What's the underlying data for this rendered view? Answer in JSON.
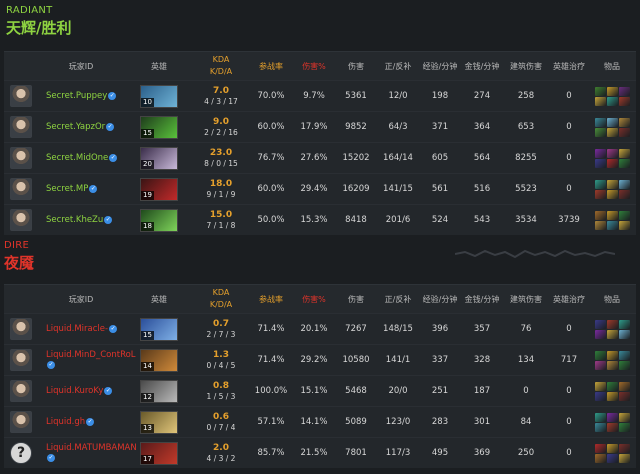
{
  "radiant": {
    "tag": "RADIANT",
    "name": "天辉/胜利",
    "players": [
      {
        "name": "Secret.Puppey",
        "level": "10",
        "kda": "7.0",
        "kda_parts": "4 / 3 / 17",
        "part": "70.0%",
        "dmg_pct": "9.7%",
        "dmg": "5361",
        "lh": "12/0",
        "xpm": "198",
        "gpm": "274",
        "bld": "258",
        "heal": "0",
        "hero_colors": [
          "#2b5f8a",
          "#6fb3d6"
        ],
        "item_colors": [
          "#3f7f2f",
          "#c59a2a",
          "#6a2d7d",
          "#c6a53a",
          "#2f9c8a",
          "#a03a2a"
        ]
      },
      {
        "name": "Secret.YapzOr",
        "level": "15",
        "kda": "9.0",
        "kda_parts": "2 / 2 / 16",
        "part": "60.0%",
        "dmg_pct": "17.9%",
        "dmg": "9852",
        "lh": "64/3",
        "xpm": "371",
        "gpm": "364",
        "bld": "653",
        "heal": "0",
        "hero_colors": [
          "#1f3d1c",
          "#59c23b"
        ],
        "item_colors": [
          "#3a8a9a",
          "#6cb0d0",
          "#b0883a",
          "#4a8f3a",
          "#c6a53a",
          "#7b2f2a"
        ]
      },
      {
        "name": "Secret.MidOne",
        "level": "20",
        "kda": "23.0",
        "kda_parts": "8 / 0 / 15",
        "part": "76.7%",
        "dmg_pct": "27.6%",
        "dmg": "15202",
        "lh": "164/14",
        "xpm": "605",
        "gpm": "564",
        "bld": "8255",
        "heal": "0",
        "hero_colors": [
          "#3a2d4a",
          "#c9b9d9"
        ],
        "item_colors": [
          "#7a2aa0",
          "#a03a8a",
          "#c6a53a",
          "#3a3a8a",
          "#b02a2a",
          "#2f7f3a"
        ]
      },
      {
        "name": "Secret.MP",
        "level": "19",
        "kda": "18.0",
        "kda_parts": "9 / 1 / 9",
        "part": "60.0%",
        "dmg_pct": "29.4%",
        "dmg": "16209",
        "lh": "141/15",
        "xpm": "561",
        "gpm": "516",
        "bld": "5523",
        "heal": "0",
        "hero_colors": [
          "#3a1414",
          "#c22a2a"
        ],
        "item_colors": [
          "#2f9c8a",
          "#c6a53a",
          "#6cb0d0",
          "#a03a2a",
          "#c59a2a",
          "#7b2f2a"
        ]
      },
      {
        "name": "Secret.KheZu",
        "level": "18",
        "kda": "15.0",
        "kda_parts": "7 / 1 / 8",
        "part": "50.0%",
        "dmg_pct": "15.3%",
        "dmg": "8418",
        "lh": "201/6",
        "xpm": "524",
        "gpm": "543",
        "bld": "3534",
        "heal": "3739",
        "hero_colors": [
          "#1f4a1c",
          "#7fd45a"
        ],
        "item_colors": [
          "#a06a2a",
          "#c59a2a",
          "#2f7f3a",
          "#b0883a",
          "#3a8a9a",
          "#c6a53a"
        ]
      }
    ]
  },
  "dire": {
    "tag": "DIRE",
    "name": "夜魇",
    "players": [
      {
        "name": "Liquid.Miracle-",
        "level": "15",
        "kda": "0.7",
        "kda_parts": "2 / 7 / 3",
        "part": "71.4%",
        "dmg_pct": "20.1%",
        "dmg": "7267",
        "lh": "148/15",
        "xpm": "396",
        "gpm": "357",
        "bld": "76",
        "heal": "0",
        "hero_colors": [
          "#2b4f9a",
          "#7fb0e6"
        ],
        "item_colors": [
          "#3a3a8a",
          "#a03a2a",
          "#2f9c8a",
          "#7a2aa0",
          "#c6a53a",
          "#6cb0d0"
        ]
      },
      {
        "name": "Liquid.MinD_ContRoL",
        "level": "14",
        "kda": "1.3",
        "kda_parts": "0 / 4 / 5",
        "part": "71.4%",
        "dmg_pct": "29.2%",
        "dmg": "10580",
        "lh": "141/1",
        "xpm": "337",
        "gpm": "328",
        "bld": "134",
        "heal": "717",
        "hero_colors": [
          "#5a3a1a",
          "#d08a3a"
        ],
        "item_colors": [
          "#2f7f3a",
          "#c59a2a",
          "#3a8a9a",
          "#a03a8a",
          "#b0883a",
          "#2f7f3a"
        ]
      },
      {
        "name": "Liquid.KuroKy",
        "level": "12",
        "kda": "0.8",
        "kda_parts": "1 / 5 / 3",
        "part": "100.0%",
        "dmg_pct": "15.1%",
        "dmg": "5468",
        "lh": "20/0",
        "xpm": "251",
        "gpm": "187",
        "bld": "0",
        "heal": "0",
        "hero_colors": [
          "#4a4a4a",
          "#b9b9b9"
        ],
        "item_colors": [
          "#c6a53a",
          "#2f7f3a",
          "#a06a2a",
          "#3a3a8a",
          "#c59a2a",
          "#7b2f2a"
        ]
      },
      {
        "name": "Liquid.gh",
        "level": "13",
        "kda": "0.6",
        "kda_parts": "0 / 7 / 4",
        "part": "57.1%",
        "dmg_pct": "14.1%",
        "dmg": "5089",
        "lh": "123/0",
        "xpm": "283",
        "gpm": "301",
        "bld": "84",
        "heal": "0",
        "hero_colors": [
          "#6a5a2a",
          "#e0c57a"
        ],
        "item_colors": [
          "#2f9c8a",
          "#7a2aa0",
          "#c6a53a",
          "#3a8a9a",
          "#a03a2a",
          "#2f7f3a"
        ]
      },
      {
        "name": "Liquid.MATUMBAMAN",
        "level": "17",
        "kda": "2.0",
        "kda_parts": "4 / 3 / 2",
        "part": "85.7%",
        "dmg_pct": "21.5%",
        "dmg": "7801",
        "lh": "117/3",
        "xpm": "495",
        "gpm": "369",
        "bld": "250",
        "heal": "0",
        "hero_colors": [
          "#5a1a1a",
          "#c23a2a"
        ],
        "item_colors": [
          "#b02a2a",
          "#c59a2a",
          "#7b2f2a",
          "#a06a2a",
          "#3a3a8a",
          "#c6a53a"
        ]
      }
    ]
  },
  "columns": {
    "player_id": "玩家ID",
    "hero": "英雄",
    "kda_top": "KDA",
    "kda_bottom": "K/D/A",
    "participation": "参战率",
    "damage_pct": "伤害%",
    "damage": "伤害",
    "last_hits": "正/反补",
    "xpm": "经验/分钟",
    "gpm": "金钱/分钟",
    "building": "建筑伤害",
    "heal": "英雄治疗",
    "items": "物品"
  },
  "verified_icon": "verified-check-icon",
  "unknown_avatar_glyph": "?",
  "colors": {
    "radiant": "#8ed341",
    "dire": "#e0342a",
    "kda": "#e5a02c"
  }
}
